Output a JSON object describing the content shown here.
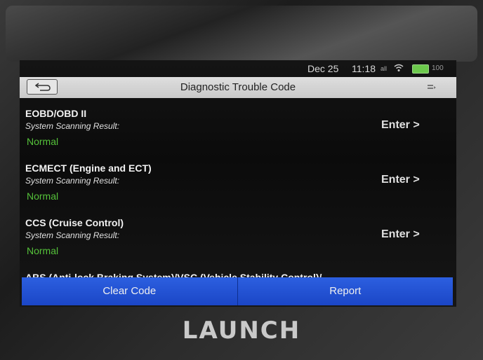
{
  "status": {
    "date": "Dec 25",
    "time": "11:18",
    "signal": "all",
    "battery": "100"
  },
  "titlebar": {
    "title": "Diagnostic Trouble Code"
  },
  "items": [
    {
      "name": "EOBD/OBD II",
      "sublabel": "System Scanning Result:",
      "status": "Normal",
      "action": "Enter >"
    },
    {
      "name": "ECMECT (Engine and ECT)",
      "sublabel": "System Scanning Result:",
      "status": "Normal",
      "action": "Enter >"
    },
    {
      "name": "CCS (Cruise Control)",
      "sublabel": "System Scanning Result:",
      "status": "Normal",
      "action": "Enter >"
    }
  ],
  "partial_item": "ABS (Anti-lock Braking System)/VSC (Vehicle Stability Control)/",
  "bottombar": {
    "clear_label": "Clear Code",
    "report_label": "Report"
  },
  "brand": "LAUNCH",
  "colors": {
    "status_normal": "#55c23a",
    "button_blue": "#2c5fe0"
  }
}
